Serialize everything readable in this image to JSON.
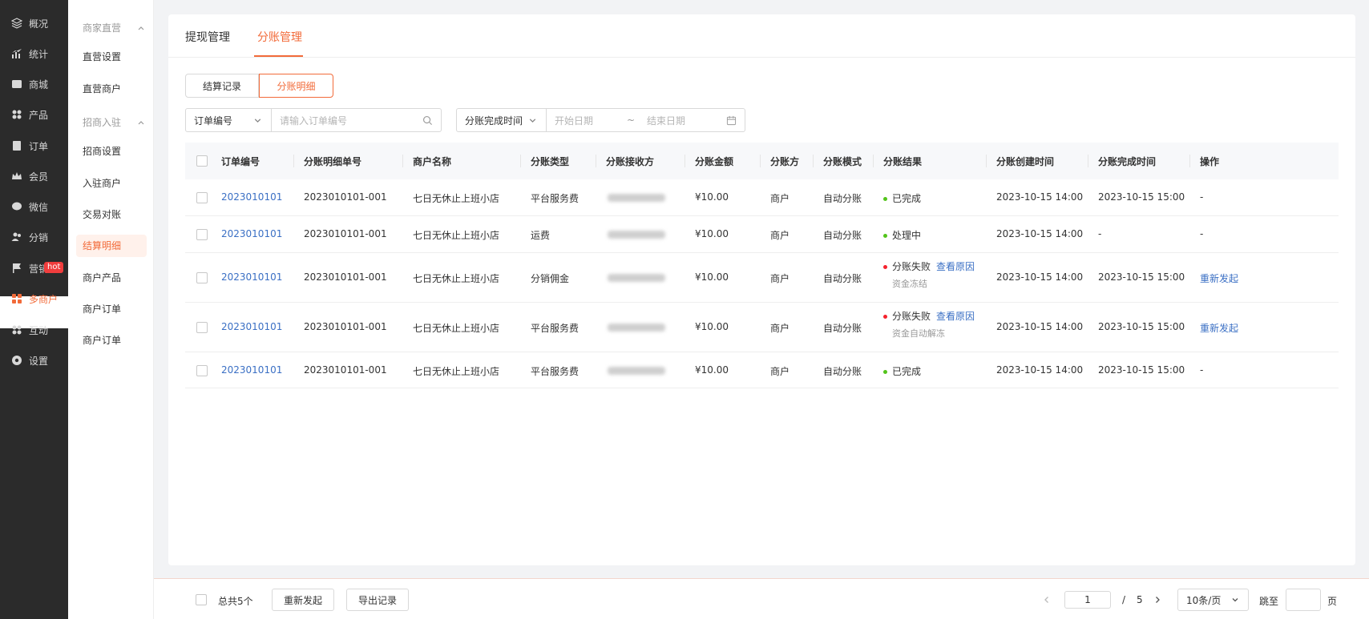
{
  "nav": {
    "items": [
      {
        "label": "概况",
        "icon": "layers-icon"
      },
      {
        "label": "统计",
        "icon": "chart-icon"
      },
      {
        "label": "商城",
        "icon": "store-icon"
      },
      {
        "label": "产品",
        "icon": "grid-icon"
      },
      {
        "label": "订单",
        "icon": "clipboard-icon"
      },
      {
        "label": "会员",
        "icon": "crown-icon"
      },
      {
        "label": "微信",
        "icon": "chat-icon"
      },
      {
        "label": "分销",
        "icon": "users-icon"
      },
      {
        "label": "营销",
        "icon": "flag-icon"
      },
      {
        "label": "多商户",
        "icon": "shop-icon"
      },
      {
        "label": "互动",
        "icon": "grid-icon"
      },
      {
        "label": "设置",
        "icon": "gear-icon"
      }
    ],
    "hot_badge": "hot"
  },
  "submenu": {
    "group1": "商家直营",
    "group1_items": [
      "直营设置",
      "直营商户"
    ],
    "group2": "招商入驻",
    "group2_items": [
      "招商设置",
      "入驻商户",
      "交易对账",
      "结算明细",
      "商户产品",
      "商户订单",
      "商户订单"
    ]
  },
  "tabs": [
    "提现管理",
    "分账管理"
  ],
  "segments": [
    "结算记录",
    "分账明细"
  ],
  "filters": {
    "order_select": "订单编号",
    "order_placeholder": "请输入订单编号",
    "time_select": "分账完成时间",
    "start_placeholder": "开始日期",
    "range_sep": "~",
    "end_placeholder": "结束日期"
  },
  "table": {
    "headers": [
      "订单编号",
      "分账明细单号",
      "商户名称",
      "分账类型",
      "分账接收方",
      "分账金额",
      "分账方",
      "分账模式",
      "分账结果",
      "分账创建时间",
      "分账完成时间",
      "操作"
    ],
    "rows": [
      {
        "order": "2023010101",
        "detail": "2023010101-001",
        "merchant": "七日无休止上班小店",
        "type": "平台服务费",
        "amount": "¥10.00",
        "party": "商户",
        "mode": "自动分账",
        "result": "已完成",
        "result_color": "#52c41a",
        "reason_link": "",
        "note": "",
        "created": "2023-10-15  14:00",
        "finished": "2023-10-15  15:00",
        "action": "-"
      },
      {
        "order": "2023010101",
        "detail": "2023010101-001",
        "merchant": "七日无休止上班小店",
        "type": "运费",
        "amount": "¥10.00",
        "party": "商户",
        "mode": "自动分账",
        "result": "处理中",
        "result_color": "#52c41a",
        "reason_link": "",
        "note": "",
        "created": "2023-10-15  14:00",
        "finished": "-",
        "action": "-"
      },
      {
        "order": "2023010101",
        "detail": "2023010101-001",
        "merchant": "七日无休止上班小店",
        "type": "分销佣金",
        "amount": "¥10.00",
        "party": "商户",
        "mode": "自动分账",
        "result": "分账失败",
        "result_color": "#f5222d",
        "reason_link": "查看原因",
        "note": "资金冻结",
        "created": "2023-10-15  14:00",
        "finished": "2023-10-15  15:00",
        "action": "重新发起"
      },
      {
        "order": "2023010101",
        "detail": "2023010101-001",
        "merchant": "七日无休止上班小店",
        "type": "平台服务费",
        "amount": "¥10.00",
        "party": "商户",
        "mode": "自动分账",
        "result": "分账失败",
        "result_color": "#f5222d",
        "reason_link": "查看原因",
        "note": "资金自动解冻",
        "created": "2023-10-15  14:00",
        "finished": "2023-10-15  15:00",
        "action": "重新发起"
      },
      {
        "order": "2023010101",
        "detail": "2023010101-001",
        "merchant": "七日无休止上班小店",
        "type": "平台服务费",
        "amount": "¥10.00",
        "party": "商户",
        "mode": "自动分账",
        "result": "已完成",
        "result_color": "#52c41a",
        "reason_link": "",
        "note": "",
        "created": "2023-10-15  14:00",
        "finished": "2023-10-15  15:00",
        "action": "-"
      }
    ]
  },
  "footer": {
    "total": "总共5个",
    "resend": "重新发起",
    "export": "导出记录",
    "page_current": "1",
    "page_sep": "/",
    "page_total": "5",
    "page_size": "10条/页",
    "jump_label": "跳至",
    "page_unit": "页"
  },
  "colors": {
    "accent": "#f26b3a",
    "link": "#3a6fc4",
    "success": "#52c41a",
    "error": "#f5222d"
  }
}
